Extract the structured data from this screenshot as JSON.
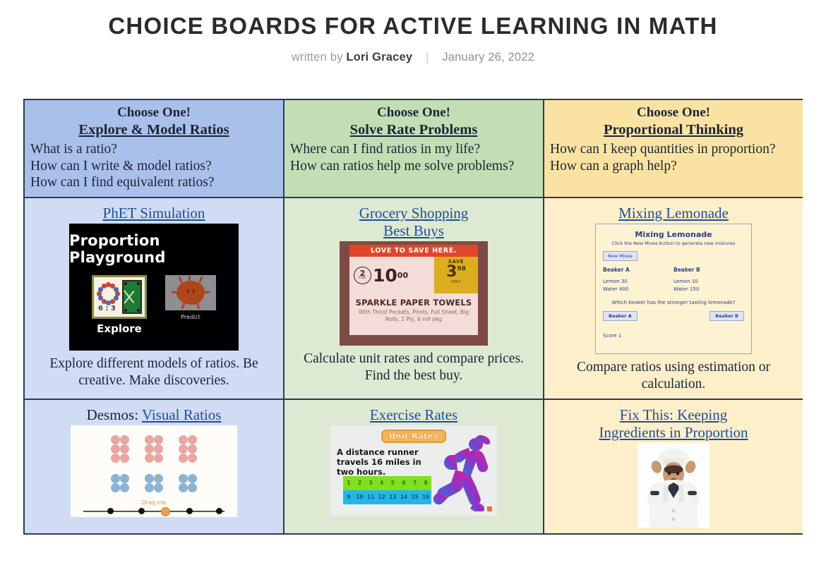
{
  "post": {
    "title": "CHOICE BOARDS FOR ACTIVE LEARNING IN MATH",
    "written_by_label": "written by",
    "author": "Lori Gracey",
    "separator": "|",
    "date": "January 26, 2022"
  },
  "board": {
    "headers": [
      {
        "choose": "Choose One!",
        "topic": "Explore & Model Ratios",
        "questions": [
          "What is a ratio?",
          "How can I write & model ratios?",
          "How can I find equivalent ratios?"
        ],
        "color": "#a9c0ea"
      },
      {
        "choose": "Choose One!",
        "topic": "Solve Rate Problems",
        "questions": [
          "Where can I find ratios in my life?",
          "How can ratios help me solve problems?"
        ],
        "color": "#c3ddb4"
      },
      {
        "choose": "Choose One!",
        "topic": "Proportional Thinking",
        "questions": [
          "How can I keep quantities in proportion?",
          "How can a graph help?"
        ],
        "color": "#fae3a2"
      }
    ],
    "row2": [
      {
        "link": "PhET Simulation",
        "caption": "Explore different models of ratios.  Be creative.  Make discoveries.",
        "thumb": {
          "kind": "phet-proportion-playground",
          "title": "Proportion Playground",
          "ratio": "6 : 3",
          "explore_label": "Explore",
          "predict_label": "Predict"
        }
      },
      {
        "link_line1": "Grocery Shopping",
        "link_line2": "Best Buys",
        "caption": "Calculate unit rates and compare prices.  Find the best buy.",
        "thumb": {
          "kind": "grocery-price-tag",
          "banner": "LOVE TO SAVE HERE.",
          "two": "2",
          "for": "FOR",
          "price": "10",
          "price_cents": "00",
          "save_label": "SAVE",
          "save_value": "3",
          "save_cents": "98",
          "only_label": "ONLY",
          "product": "SPARKLE PAPER TOWELS",
          "description": "With Thirst Pockets, Prints, Full Sheet, Big Rolls, 2 Ply, 6 roll pkg"
        }
      },
      {
        "link": "Mixing Lemonade",
        "caption": "Compare ratios using estimation or calculation.",
        "thumb": {
          "kind": "mixing-lemonade-applet",
          "title": "Mixing Lemonade",
          "subtitle": "Click the New Mixes button to generate new mixtures",
          "new_mixes_button": "New Mixes",
          "beaker_a_label": "Beaker A",
          "beaker_b_label": "Beaker B",
          "beaker_a_lemon": "Lemon 30",
          "beaker_a_water": "Water 400",
          "beaker_b_lemon": "Lemon 10",
          "beaker_b_water": "Water 150",
          "question": "Which beaker has the stronger tasting lemonade?",
          "answer_a": "Beaker A",
          "answer_b": "Beaker B",
          "score": "Score 1"
        }
      }
    ],
    "row3": [
      {
        "link_prefix": "Desmos:",
        "link": "Visual Ratios",
        "thumb": {
          "kind": "desmos-visual-ratios",
          "drag_label": "Drag me",
          "red_groups": 3,
          "red_per_group": 6,
          "blue_groups": 3,
          "blue_per_group": 4
        }
      },
      {
        "link": "Exercise Rates",
        "thumb": {
          "kind": "unit-rates-runner",
          "badge": "Unit Rates",
          "statement": "A distance runner travels 16 miles in two hours.",
          "strip_top": [
            "1",
            "2",
            "3",
            "4",
            "5",
            "6",
            "7",
            "8"
          ],
          "strip_bottom": [
            "9",
            "10",
            "11",
            "12",
            "13",
            "14",
            "15",
            "16"
          ]
        }
      },
      {
        "link_line1": "Fix This:  Keeping",
        "link_line2": "Ingredients in Proportion",
        "thumb": {
          "kind": "frustrated-chef-photo"
        }
      }
    ]
  }
}
